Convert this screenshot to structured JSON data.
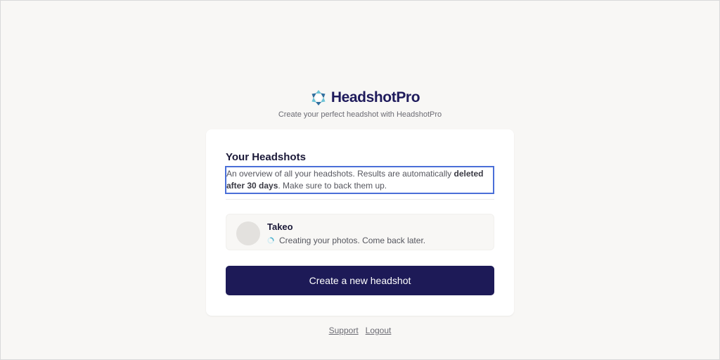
{
  "brand": {
    "name": "HeadshotPro",
    "tagline": "Create your perfect headshot with HeadshotPro",
    "logo_colors": [
      "#6cc3d6",
      "#2f6f9f"
    ]
  },
  "card": {
    "title": "Your Headshots",
    "description_prefix": "An overview of all your headshots. Results are automatically ",
    "description_bold": "deleted after 30 days",
    "description_suffix": ". Make sure to back them up."
  },
  "headshots": [
    {
      "name": "Takeo",
      "status": "Creating your photos. Come back later.",
      "status_icon": "spinner-icon"
    }
  ],
  "actions": {
    "create_label": "Create a new headshot"
  },
  "footer": {
    "support_label": "Support",
    "logout_label": "Logout"
  },
  "colors": {
    "background": "#f8f7f5",
    "primary_button": "#1d1a57",
    "focus_outline": "#4a6fd8"
  }
}
